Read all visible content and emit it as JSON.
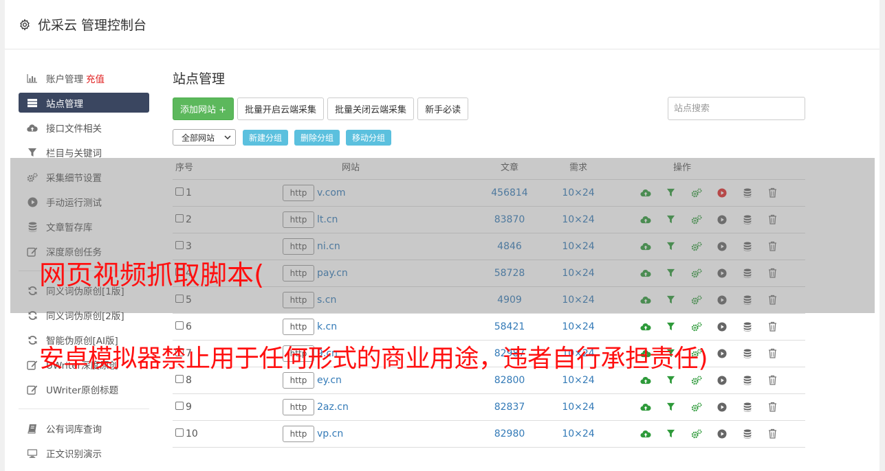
{
  "header": {
    "title": "优采云 管理控制台"
  },
  "sidebar": {
    "items": [
      {
        "label": "账户管理",
        "badge": "充值",
        "icon": "bar-chart-icon"
      },
      {
        "label": "站点管理",
        "icon": "server-icon",
        "active": true
      },
      {
        "label": "接口文件相关",
        "icon": "cloud-upload-icon"
      },
      {
        "label": "栏目与关键词",
        "icon": "filter-icon"
      },
      {
        "label": "采集细节设置",
        "icon": "cogs-icon"
      },
      {
        "label": "手动运行测试",
        "icon": "play-icon"
      },
      {
        "label": "文章暂存库",
        "icon": "database-icon"
      },
      {
        "label": "深度原创任务",
        "icon": "edit-icon"
      }
    ],
    "items2": [
      {
        "label": "同义词伪原创[1版]",
        "icon": "refresh-icon"
      },
      {
        "label": "同义词伪原创[2版]",
        "icon": "refresh-icon"
      },
      {
        "label": "智能伪原创[AI版]",
        "icon": "refresh-icon"
      },
      {
        "label": "UWriter深度原创",
        "icon": "edit-icon"
      },
      {
        "label": "UWriter原创标题",
        "icon": "edit-icon"
      }
    ],
    "items3": [
      {
        "label": "公有词库查询",
        "icon": "book-icon"
      },
      {
        "label": "正文识别演示",
        "icon": "monitor-icon"
      }
    ]
  },
  "main": {
    "title": "站点管理",
    "buttons": {
      "add": "添加网站 +",
      "batch_open": "批量开启云端采集",
      "batch_close": "批量关闭云端采集",
      "guide": "新手必读"
    },
    "search_placeholder": "站点搜索",
    "group_select": "全部网站",
    "group_buttons": {
      "new": "新建分组",
      "delete": "删除分组",
      "move": "移动分组"
    },
    "table": {
      "headers": {
        "num": "序号",
        "site": "网站",
        "articles": "文章",
        "demand": "需求",
        "ops": "操作"
      },
      "rows": [
        {
          "num": "1",
          "proto": "http",
          "site": "v.com",
          "articles": "456814",
          "demand": "10×24",
          "active": true
        },
        {
          "num": "2",
          "proto": "http",
          "site": "lt.cn",
          "articles": "83870",
          "demand": "10×24",
          "active": false
        },
        {
          "num": "3",
          "proto": "http",
          "site": "ni.cn",
          "articles": "4846",
          "demand": "10×24",
          "active": false
        },
        {
          "num": "4",
          "proto": "http",
          "site": "pay.cn",
          "articles": "58728",
          "demand": "10×24",
          "active": false
        },
        {
          "num": "5",
          "proto": "http",
          "site": "s.cn",
          "articles": "4909",
          "demand": "10×24",
          "active": false
        },
        {
          "num": "6",
          "proto": "http",
          "site": "k.cn",
          "articles": "58421",
          "demand": "10×24",
          "active": false
        },
        {
          "num": "7",
          "proto": "http",
          "site": "9.cn",
          "articles": "82987",
          "demand": "10×24",
          "active": false
        },
        {
          "num": "8",
          "proto": "http",
          "site": "ey.cn",
          "articles": "82800",
          "demand": "10×24",
          "active": false
        },
        {
          "num": "9",
          "proto": "http",
          "site": "2az.cn",
          "articles": "82837",
          "demand": "10×24",
          "active": false
        },
        {
          "num": "10",
          "proto": "http",
          "site": "vp.cn",
          "articles": "82980",
          "demand": "10×24",
          "active": false
        }
      ]
    }
  },
  "watermark": {
    "line1": "网页视频抓取脚本(",
    "line2": "安卓模拟器禁止用于任何形式的商业用途，违者自行承担责任)"
  },
  "colors": {
    "green": "#5cb85c",
    "info": "#5bc0de",
    "active_bg": "#3a4660",
    "link": "#337ab7",
    "watermark": "#ff1010",
    "op_green": "#2e9a3a",
    "op_red": "#e02828"
  }
}
